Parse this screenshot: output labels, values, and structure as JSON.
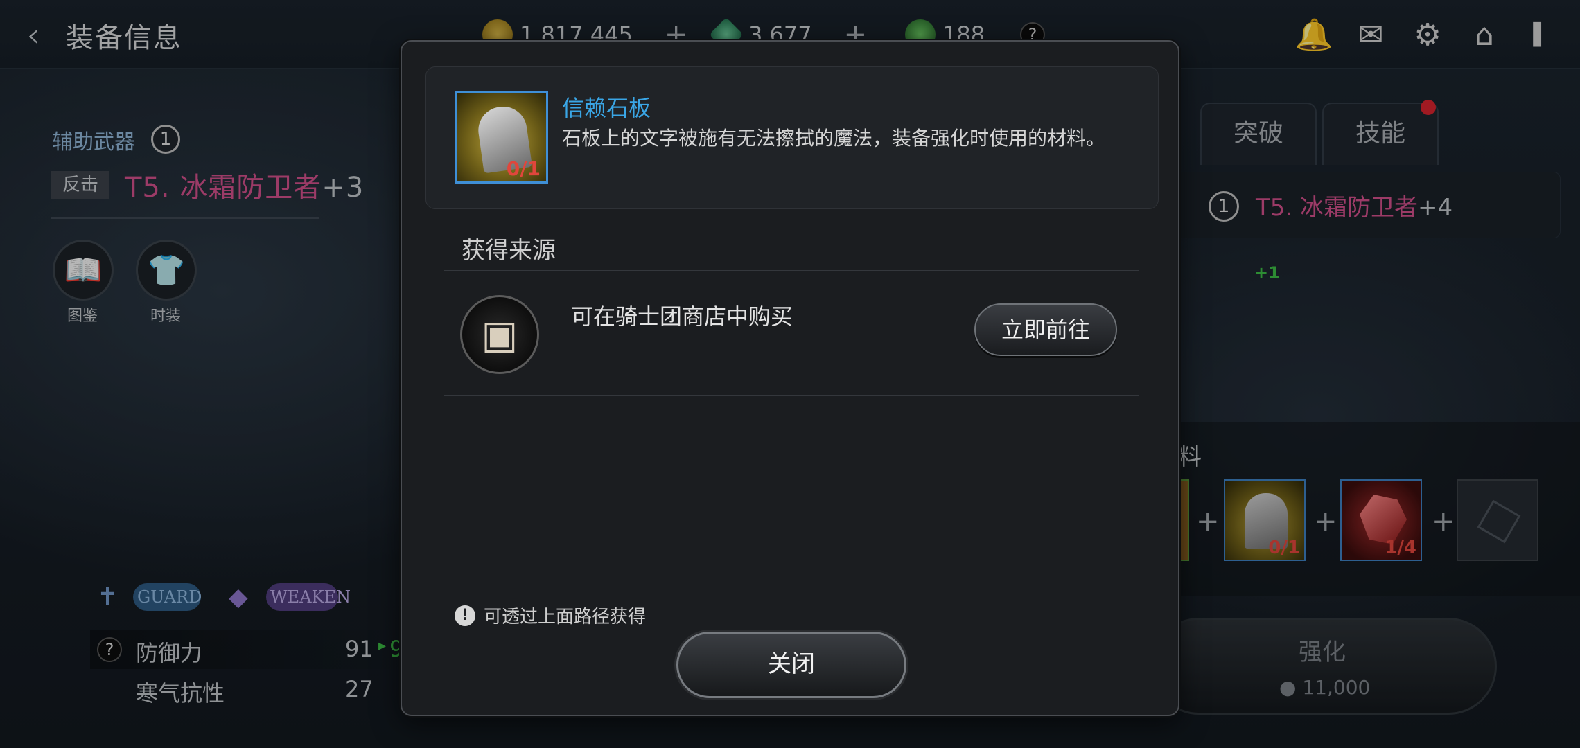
{
  "header": {
    "title": "装备信息",
    "currencies": [
      {
        "name": "gold-coin",
        "value": "1,817,445",
        "color": "#c9a21a"
      },
      {
        "name": "green-crystal",
        "value": "3,677",
        "color": "#2f9c6b"
      },
      {
        "name": "energy",
        "value": "188",
        "color": "#3aa44f"
      }
    ],
    "icons": [
      "bell-icon",
      "chat-icon",
      "gear-icon",
      "home-icon",
      "signal-battery-icon"
    ]
  },
  "left": {
    "slot_label": "辅助武器",
    "slot_badge": "1",
    "tag": "反击",
    "item_name": "T5. 冰霜防卫者",
    "item_level": "+3",
    "buttons": [
      {
        "label": "图鉴",
        "icon": "book-icon"
      },
      {
        "label": "时装",
        "icon": "costume-icon"
      }
    ],
    "pills": [
      "GUARD",
      "WEAKEN"
    ],
    "stats": [
      {
        "name": "防御力",
        "value": "91",
        "next": "9"
      },
      {
        "name": "寒气抗性",
        "value": "27"
      }
    ]
  },
  "right": {
    "tabs": [
      "突破",
      "技能"
    ],
    "badge": "1",
    "item_name": "T5. 冰霜防卫者",
    "item_level": "+4",
    "green_bonus": "+1",
    "materials_title": "料",
    "materials": [
      {
        "name": "trust-stone-tablet",
        "count": "0/1"
      },
      {
        "name": "red-gem",
        "count": "1/4"
      }
    ],
    "enhance_label": "强化",
    "enhance_cost": "11,000"
  },
  "modal": {
    "item_name": "信赖石板",
    "item_count": "0/1",
    "description": "石板上的文字被施有无法擦拭的魔法，装备强化时使用的材料。",
    "source_title": "获得来源",
    "source_text": "可在骑士团商店中购买",
    "go_button": "立即前往",
    "note": "可透过上面路径获得",
    "close_button": "关闭"
  }
}
